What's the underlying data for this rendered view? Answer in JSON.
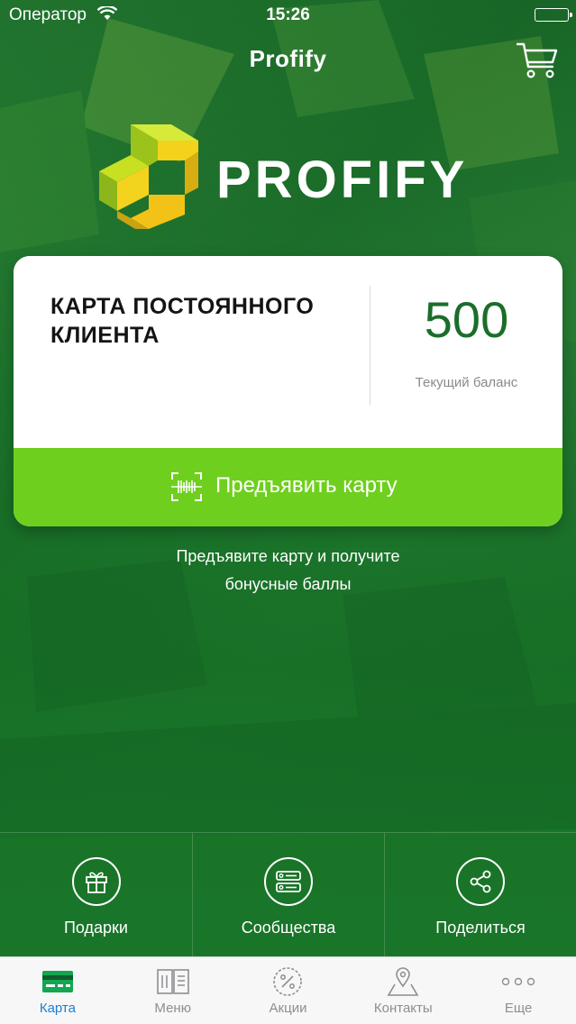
{
  "status_bar": {
    "carrier": "Оператор",
    "time": "15:26"
  },
  "nav": {
    "title": "Profify",
    "cart_icon": "cart-icon"
  },
  "logo": {
    "text": "PROFIFY",
    "mark_colors": [
      "#c8e022",
      "#f2d21a",
      "#9bc31c"
    ]
  },
  "card": {
    "title": "КАРТА ПОСТОЯННОГО КЛИЕНТА",
    "balance": "500",
    "balance_label": "Текущий баланс",
    "button_label": "Предъявить карту",
    "button_icon": "barcode-scan-icon",
    "colors": {
      "button": "#6fcf1f",
      "balance": "#1b6e2a"
    }
  },
  "hint": {
    "line1": "Предъявите карту и получите",
    "line2": "бонусные баллы"
  },
  "actions": [
    {
      "label": "Подарки",
      "icon": "gift-icon"
    },
    {
      "label": "Сообщества",
      "icon": "communities-icon"
    },
    {
      "label": "Поделиться",
      "icon": "share-icon"
    }
  ],
  "tabbar": {
    "items": [
      {
        "label": "Карта",
        "icon": "card-icon",
        "active": true
      },
      {
        "label": "Меню",
        "icon": "menu-book-icon",
        "active": false
      },
      {
        "label": "Акции",
        "icon": "percent-badge-icon",
        "active": false
      },
      {
        "label": "Контакты",
        "icon": "map-pin-icon",
        "active": false
      },
      {
        "label": "Еще",
        "icon": "more-icon",
        "active": false
      }
    ],
    "active_color": "#1a7fd6"
  }
}
